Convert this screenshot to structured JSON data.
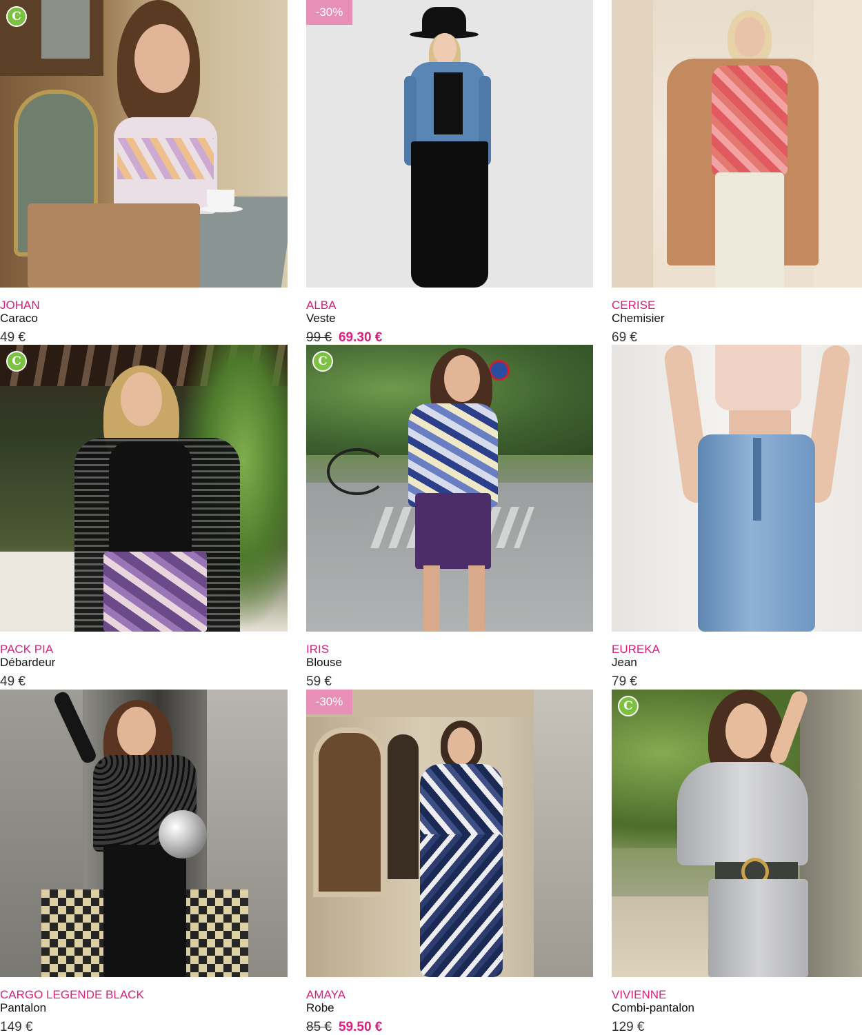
{
  "colors": {
    "brand_pink": "#d8207d",
    "discount_badge": "#e88fb7",
    "eco_badge": "#7cc142",
    "text": "#111111"
  },
  "products": [
    {
      "brand": "JOHAN",
      "category": "Caraco",
      "price": "49 €",
      "badge": "eco",
      "badge_icon": "eco-c-icon",
      "badge_text": "C"
    },
    {
      "brand": "ALBA",
      "category": "Veste",
      "old_price": "99 €",
      "new_price": "69.30 €",
      "badge": "discount",
      "badge_text": "-30%"
    },
    {
      "brand": "CERISE",
      "category": "Chemisier",
      "price": "69 €",
      "badge": "none"
    },
    {
      "brand": "PACK PIA",
      "category": "Débardeur",
      "price": "49 €",
      "badge": "eco",
      "badge_icon": "eco-c-icon",
      "badge_text": "C"
    },
    {
      "brand": "IRIS",
      "category": "Blouse",
      "price": "59 €",
      "badge": "eco",
      "badge_icon": "eco-c-icon",
      "badge_text": "C"
    },
    {
      "brand": "EUREKA",
      "category": "Jean",
      "price": "79 €",
      "badge": "none"
    },
    {
      "brand": "CARGO LEGENDE BLACK",
      "category": "Pantalon",
      "price": "149 €",
      "badge": "none"
    },
    {
      "brand": "AMAYA",
      "category": "Robe",
      "old_price": "85 €",
      "new_price": "59.50 €",
      "badge": "discount",
      "badge_text": "-30%"
    },
    {
      "brand": "VIVIENNE",
      "category": "Combi-pantalon",
      "price": "129 €",
      "badge": "eco",
      "badge_icon": "eco-c-icon",
      "badge_text": "C"
    }
  ]
}
